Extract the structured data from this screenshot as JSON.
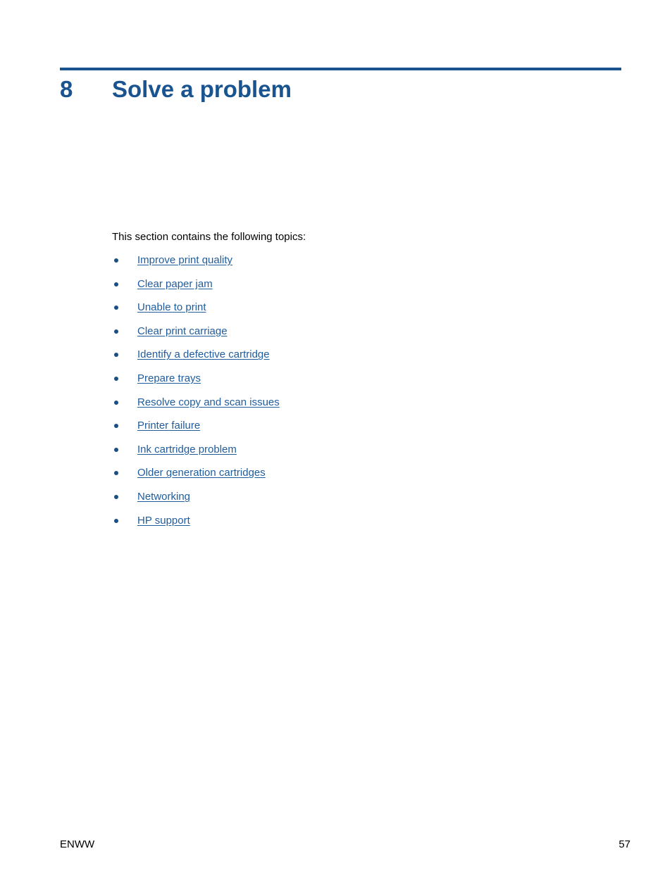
{
  "document": {
    "chapter_number": "8",
    "chapter_title": "Solve a problem",
    "intro_text": "This section contains the following topics:",
    "accent_color": "#1a5490",
    "link_color": "#1f5c9e",
    "bullet_color": "#1a4f86",
    "body_color": "#000000",
    "background_color": "#ffffff"
  },
  "topics": [
    {
      "label": "Improve print quality"
    },
    {
      "label": "Clear paper jam"
    },
    {
      "label": "Unable to print"
    },
    {
      "label": "Clear print carriage"
    },
    {
      "label": "Identify a defective cartridge"
    },
    {
      "label": "Prepare trays"
    },
    {
      "label": "Resolve copy and scan issues"
    },
    {
      "label": "Printer failure"
    },
    {
      "label": "Ink cartridge problem"
    },
    {
      "label": "Older generation cartridges"
    },
    {
      "label": "Networking"
    },
    {
      "label": "HP support"
    }
  ],
  "footer": {
    "locale_code": "ENWW",
    "page_number": "57"
  }
}
